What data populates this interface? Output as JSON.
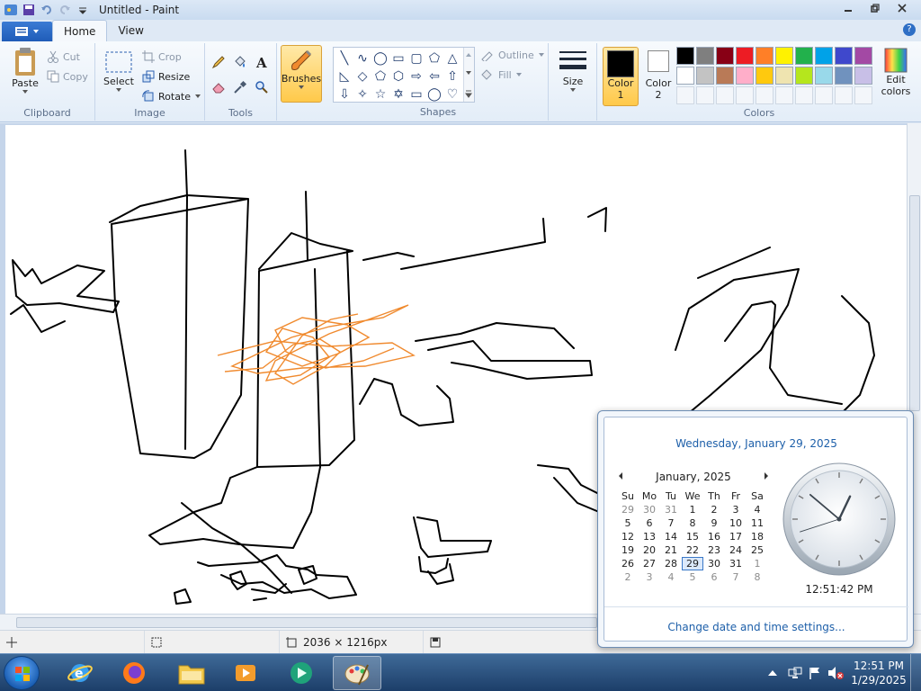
{
  "window": {
    "title": "Untitled - Paint"
  },
  "tabs": [
    {
      "label": "Home"
    },
    {
      "label": "View"
    }
  ],
  "groups": {
    "clipboard": "Clipboard",
    "image": "Image",
    "tools": "Tools",
    "shapes": "Shapes",
    "colors": "Colors"
  },
  "ribbon": {
    "paste": "Paste",
    "cut": "Cut",
    "copy": "Copy",
    "select": "Select",
    "crop": "Crop",
    "resize": "Resize",
    "rotate": "Rotate",
    "brushes": "Brushes",
    "outline": "Outline",
    "fill": "Fill",
    "size": "Size",
    "color1_line1": "Color",
    "color1_line2": "1",
    "color2_line1": "Color",
    "color2_line2": "2",
    "edit_colors_line1": "Edit",
    "edit_colors_line2": "colors"
  },
  "colors": {
    "color1": "#000000",
    "color2": "#ffffff",
    "palette_row1": [
      "#000000",
      "#7f7f7f",
      "#880015",
      "#ed1c24",
      "#ff7f27",
      "#fff200",
      "#22b14c",
      "#00a2e8",
      "#3f48cc",
      "#a349a4"
    ],
    "palette_row2": [
      "#ffffff",
      "#c3c3c3",
      "#b97a57",
      "#ffaec9",
      "#ffc90e",
      "#efe4b0",
      "#b5e61d",
      "#99d9ea",
      "#7092be",
      "#c8bfe7"
    ],
    "accent": "#1d5fa9",
    "brush_orange": "#f08a2e"
  },
  "statusbar": {
    "dimensions": "2036 × 1216px"
  },
  "taskbar": {
    "time": "12:51 PM",
    "date": "1/29/2025"
  },
  "calendar": {
    "long_date": "Wednesday, January 29, 2025",
    "month": "January, 2025",
    "weekdays": [
      "Su",
      "Mo",
      "Tu",
      "We",
      "Th",
      "Fr",
      "Sa"
    ],
    "weeks": [
      [
        "29",
        "30",
        "31",
        "1",
        "2",
        "3",
        "4"
      ],
      [
        "5",
        "6",
        "7",
        "8",
        "9",
        "10",
        "11"
      ],
      [
        "12",
        "13",
        "14",
        "15",
        "16",
        "17",
        "18"
      ],
      [
        "19",
        "20",
        "21",
        "22",
        "23",
        "24",
        "25"
      ],
      [
        "26",
        "27",
        "28",
        "29",
        "30",
        "31",
        "1"
      ],
      [
        "2",
        "3",
        "4",
        "5",
        "6",
        "7",
        "8"
      ]
    ],
    "time": "12:51:42 PM",
    "link": "Change date and time settings..."
  }
}
